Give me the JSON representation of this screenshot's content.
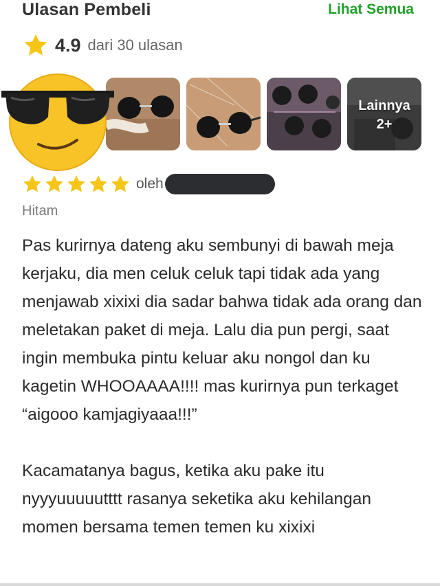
{
  "header": {
    "title": "Ulasan Pembeli",
    "see_all_label": "Lihat Semua"
  },
  "rating": {
    "value": "4.9",
    "count_text": "dari 30 ulasan",
    "star_color": "#f5c518"
  },
  "media": {
    "thumbnails": [
      "photo-sunglasses-1",
      "photo-sunglasses-2",
      "photo-sunglasses-3",
      "photo-sunglasses-4"
    ],
    "more": {
      "label": "Lainnya",
      "count": "2+"
    }
  },
  "review": {
    "stars": 5,
    "by_label": "oleh",
    "variant": "Hitam",
    "paragraphs": [
      "Pas kurirnya dateng aku sembunyi di bawah meja kerjaku, dia men celuk celuk tapi tidak ada yang menjawab xixixi dia sadar bahwa tidak ada orang dan meletakan paket di meja. Lalu dia pun pergi, saat ingin membuka pintu keluar aku nongol dan ku kagetin WHOOAAAA!!!! mas kurirnya pun terkaget “aigooo kamjagiyaaa!!!”",
      "Kacamatanya bagus, ketika aku pake itu nyyyuuuuutttt rasanya seketika aku kehilangan momen bersama temen temen ku xixixi"
    ]
  },
  "colors": {
    "accent_green": "#22a12a",
    "star_yellow": "#f5c518"
  },
  "icons": {
    "rating": "star-icon",
    "overlay": "sunglasses-emoji"
  }
}
